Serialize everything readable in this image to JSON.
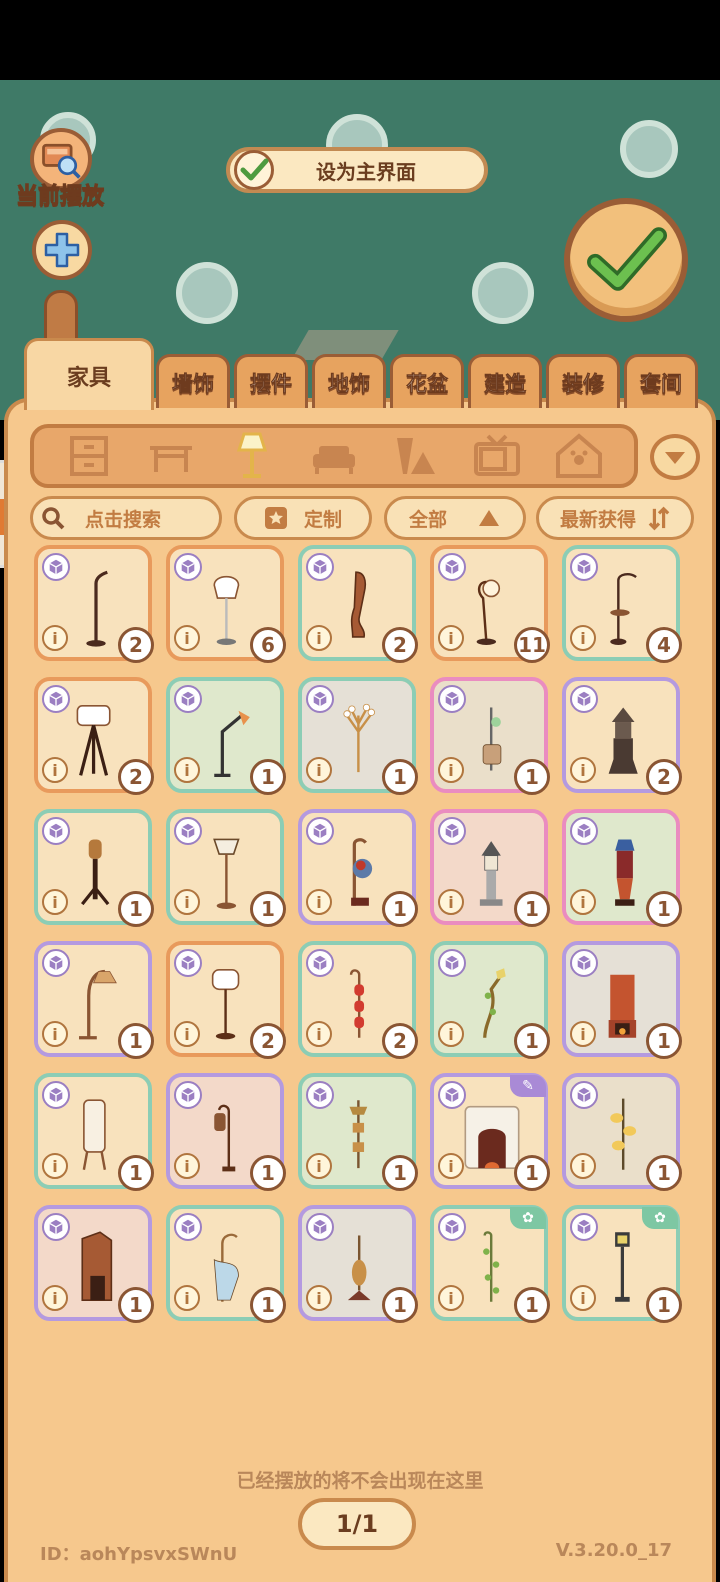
{
  "colors": {
    "scene_bg": "#3f7a67",
    "panel_bg": "#f6c88d",
    "accent_brown": "#9a5d36",
    "confirm_green": "#4e9b3f"
  },
  "top_left": {
    "current_place_label": "当前摆放",
    "search_icon": "magnifier-on-furniture-icon",
    "add_icon": "plus-icon"
  },
  "main_toggle": {
    "label": "设为主界面",
    "checked": true
  },
  "tabs": [
    {
      "label": "家具",
      "active": true
    },
    {
      "label": "墙饰"
    },
    {
      "label": "摆件"
    },
    {
      "label": "地饰"
    },
    {
      "label": "花盆"
    },
    {
      "label": "建造"
    },
    {
      "label": "装修"
    },
    {
      "label": "套间"
    }
  ],
  "categories": [
    "cabinet-icon",
    "table-icon",
    "floor-lamp-icon",
    "sofa-icon",
    "decor-icon",
    "tv-icon",
    "pet-house-icon"
  ],
  "active_category": "floor-lamp-icon",
  "filters": {
    "search_placeholder": "点击搜索",
    "custom_label": "定制",
    "all_label": "全部",
    "sort_label": "最新获得"
  },
  "items": [
    {
      "count": "2",
      "rarity": "common",
      "bg": "plain"
    },
    {
      "count": "6",
      "rarity": "common",
      "bg": "plain"
    },
    {
      "count": "2",
      "rarity": "green",
      "bg": "plain"
    },
    {
      "count": "11",
      "rarity": "common",
      "bg": "plain"
    },
    {
      "count": "4",
      "rarity": "green",
      "bg": "plain"
    },
    {
      "count": "2",
      "rarity": "common",
      "bg": "plain"
    },
    {
      "count": "1",
      "rarity": "green",
      "bg": "scene"
    },
    {
      "count": "1",
      "rarity": "green",
      "bg": "scene"
    },
    {
      "count": "1",
      "rarity": "pink",
      "bg": "scene"
    },
    {
      "count": "2",
      "rarity": "purple",
      "bg": "plain"
    },
    {
      "count": "1",
      "rarity": "green",
      "bg": "plain"
    },
    {
      "count": "1",
      "rarity": "green",
      "bg": "plain"
    },
    {
      "count": "1",
      "rarity": "purple",
      "bg": "plain"
    },
    {
      "count": "1",
      "rarity": "pink",
      "bg": "scene"
    },
    {
      "count": "1",
      "rarity": "pink",
      "bg": "scene"
    },
    {
      "count": "1",
      "rarity": "purple",
      "bg": "plain"
    },
    {
      "count": "2",
      "rarity": "common",
      "bg": "plain"
    },
    {
      "count": "2",
      "rarity": "green",
      "bg": "plain"
    },
    {
      "count": "1",
      "rarity": "green",
      "bg": "scene"
    },
    {
      "count": "1",
      "rarity": "purple",
      "bg": "scene"
    },
    {
      "count": "1",
      "rarity": "green",
      "bg": "plain"
    },
    {
      "count": "1",
      "rarity": "purple",
      "bg": "scene"
    },
    {
      "count": "1",
      "rarity": "green",
      "bg": "scene"
    },
    {
      "count": "1",
      "rarity": "purple",
      "bg": "plain",
      "corner": "brush"
    },
    {
      "count": "1",
      "rarity": "purple",
      "bg": "scene"
    },
    {
      "count": "1",
      "rarity": "purple",
      "bg": "scene"
    },
    {
      "count": "1",
      "rarity": "green",
      "bg": "plain"
    },
    {
      "count": "1",
      "rarity": "purple",
      "bg": "scene"
    },
    {
      "count": "1",
      "rarity": "green",
      "bg": "plain",
      "corner": "flower"
    },
    {
      "count": "1",
      "rarity": "green",
      "bg": "plain",
      "corner": "flower"
    }
  ],
  "footer": {
    "note": "已经摆放的将不会出现在这里",
    "page": "1/1",
    "id": "ID：aohYpsvxSWnU",
    "version": "V.3.20.0_17"
  }
}
